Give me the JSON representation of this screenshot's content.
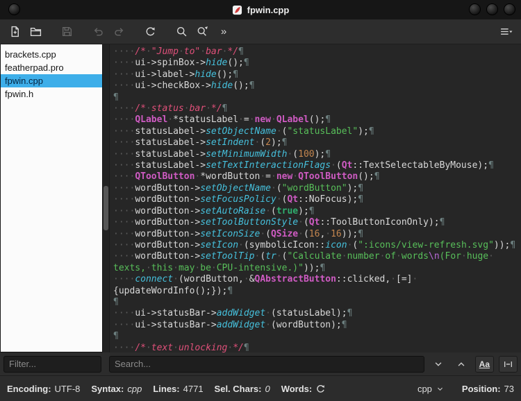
{
  "window": {
    "title": "fpwin.cpp"
  },
  "toolbar": {
    "overflow_label": "»",
    "icons": [
      "new-file-icon",
      "open-file-icon",
      "save-icon",
      "undo-icon",
      "redo-icon",
      "reload-icon",
      "search-icon",
      "find-replace-icon",
      "overflow-chevrons",
      "menu-icon"
    ]
  },
  "sidebar": {
    "filter_placeholder": "Filter...",
    "files": [
      {
        "name": "brackets.cpp",
        "selected": false
      },
      {
        "name": "featherpad.pro",
        "selected": false
      },
      {
        "name": "fpwin.cpp",
        "selected": true
      },
      {
        "name": "fpwin.h",
        "selected": false
      }
    ]
  },
  "search": {
    "placeholder": "Search...",
    "case_button_label": "Aa"
  },
  "statusbar": {
    "encoding_label": "Encoding:",
    "encoding_value": "UTF-8",
    "syntax_label": "Syntax:",
    "syntax_value": "cpp",
    "lines_label": "Lines:",
    "lines_value": "4771",
    "sel_label": "Sel. Chars:",
    "sel_value": "0",
    "words_label": "Words:",
    "lang_combo_value": "cpp",
    "position_label": "Position:",
    "position_value": "73"
  },
  "editor": {
    "rows": [
      [
        [
          "ws",
          "····"
        ],
        [
          "c",
          "/*"
        ],
        [
          "ws",
          "·"
        ],
        [
          "c",
          "\"Jump"
        ],
        [
          "ws",
          "·"
        ],
        [
          "c",
          "to\""
        ],
        [
          "ws",
          "·"
        ],
        [
          "c",
          "bar"
        ],
        [
          "ws",
          "·"
        ],
        [
          "c",
          "*/"
        ],
        [
          "pi",
          "¶"
        ]
      ],
      [
        [
          "ws",
          "····"
        ],
        [
          "p",
          "ui->spinBox->"
        ],
        [
          "f",
          "hide"
        ],
        [
          "p",
          "();"
        ],
        [
          "pi",
          "¶"
        ]
      ],
      [
        [
          "ws",
          "····"
        ],
        [
          "p",
          "ui->label->"
        ],
        [
          "f",
          "hide"
        ],
        [
          "p",
          "();"
        ],
        [
          "pi",
          "¶"
        ]
      ],
      [
        [
          "ws",
          "····"
        ],
        [
          "p",
          "ui->checkBox->"
        ],
        [
          "f",
          "hide"
        ],
        [
          "p",
          "();"
        ],
        [
          "pi",
          "¶"
        ]
      ],
      [
        [
          "pi",
          "¶"
        ]
      ],
      [
        [
          "ws",
          "····"
        ],
        [
          "c",
          "/*"
        ],
        [
          "ws",
          "·"
        ],
        [
          "c",
          "status"
        ],
        [
          "ws",
          "·"
        ],
        [
          "c",
          "bar"
        ],
        [
          "ws",
          "·"
        ],
        [
          "c",
          "*/"
        ],
        [
          "pi",
          "¶"
        ]
      ],
      [
        [
          "ws",
          "····"
        ],
        [
          "k",
          "QLabel"
        ],
        [
          "ws",
          "·"
        ],
        [
          "p",
          "*statusLabel"
        ],
        [
          "ws",
          "·"
        ],
        [
          "p",
          "="
        ],
        [
          "ws",
          "·"
        ],
        [
          "k",
          "new"
        ],
        [
          "ws",
          "·"
        ],
        [
          "k",
          "QLabel"
        ],
        [
          "p",
          "();"
        ],
        [
          "pi",
          "¶"
        ]
      ],
      [
        [
          "ws",
          "····"
        ],
        [
          "p",
          "statusLabel->"
        ],
        [
          "f",
          "setObjectName"
        ],
        [
          "ws",
          "·"
        ],
        [
          "p",
          "("
        ],
        [
          "s",
          "\"statusLabel\""
        ],
        [
          "p",
          ");"
        ],
        [
          "pi",
          "¶"
        ]
      ],
      [
        [
          "ws",
          "····"
        ],
        [
          "p",
          "statusLabel->"
        ],
        [
          "f",
          "setIndent"
        ],
        [
          "ws",
          "·"
        ],
        [
          "p",
          "("
        ],
        [
          "n",
          "2"
        ],
        [
          "p",
          ");"
        ],
        [
          "pi",
          "¶"
        ]
      ],
      [
        [
          "ws",
          "····"
        ],
        [
          "p",
          "statusLabel->"
        ],
        [
          "f",
          "setMinimumWidth"
        ],
        [
          "ws",
          "·"
        ],
        [
          "p",
          "("
        ],
        [
          "n",
          "100"
        ],
        [
          "p",
          ");"
        ],
        [
          "pi",
          "¶"
        ]
      ],
      [
        [
          "ws",
          "····"
        ],
        [
          "p",
          "statusLabel->"
        ],
        [
          "f",
          "setTextInteractionFlags"
        ],
        [
          "ws",
          "·"
        ],
        [
          "p",
          "("
        ],
        [
          "k",
          "Qt"
        ],
        [
          "p",
          "::TextSelectableByMouse);"
        ],
        [
          "pi",
          "¶"
        ]
      ],
      [
        [
          "ws",
          "····"
        ],
        [
          "k",
          "QToolButton"
        ],
        [
          "ws",
          "·"
        ],
        [
          "p",
          "*wordButton"
        ],
        [
          "ws",
          "·"
        ],
        [
          "p",
          "="
        ],
        [
          "ws",
          "·"
        ],
        [
          "k",
          "new"
        ],
        [
          "ws",
          "·"
        ],
        [
          "k",
          "QToolButton"
        ],
        [
          "p",
          "();"
        ],
        [
          "pi",
          "¶"
        ]
      ],
      [
        [
          "ws",
          "····"
        ],
        [
          "p",
          "wordButton->"
        ],
        [
          "f",
          "setObjectName"
        ],
        [
          "ws",
          "·"
        ],
        [
          "p",
          "("
        ],
        [
          "s",
          "\"wordButton\""
        ],
        [
          "p",
          ");"
        ],
        [
          "pi",
          "¶"
        ]
      ],
      [
        [
          "ws",
          "····"
        ],
        [
          "p",
          "wordButton->"
        ],
        [
          "f",
          "setFocusPolicy"
        ],
        [
          "ws",
          "·"
        ],
        [
          "p",
          "("
        ],
        [
          "k",
          "Qt"
        ],
        [
          "p",
          "::NoFocus);"
        ],
        [
          "pi",
          "¶"
        ]
      ],
      [
        [
          "ws",
          "····"
        ],
        [
          "p",
          "wordButton->"
        ],
        [
          "f",
          "setAutoRaise"
        ],
        [
          "ws",
          "·"
        ],
        [
          "p",
          "("
        ],
        [
          "b",
          "true"
        ],
        [
          "p",
          ");"
        ],
        [
          "pi",
          "¶"
        ]
      ],
      [
        [
          "ws",
          "····"
        ],
        [
          "p",
          "wordButton->"
        ],
        [
          "f",
          "setToolButtonStyle"
        ],
        [
          "ws",
          "·"
        ],
        [
          "p",
          "("
        ],
        [
          "k",
          "Qt"
        ],
        [
          "p",
          "::ToolButtonIconOnly);"
        ],
        [
          "pi",
          "¶"
        ]
      ],
      [
        [
          "ws",
          "····"
        ],
        [
          "p",
          "wordButton->"
        ],
        [
          "f",
          "setIconSize"
        ],
        [
          "ws",
          "·"
        ],
        [
          "p",
          "("
        ],
        [
          "k",
          "QSize"
        ],
        [
          "ws",
          "·"
        ],
        [
          "p",
          "("
        ],
        [
          "n",
          "16"
        ],
        [
          "p",
          ","
        ],
        [
          "ws",
          "·"
        ],
        [
          "n",
          "16"
        ],
        [
          "p",
          "));"
        ],
        [
          "pi",
          "¶"
        ]
      ],
      [
        [
          "ws",
          "····"
        ],
        [
          "p",
          "wordButton->"
        ],
        [
          "f",
          "setIcon"
        ],
        [
          "ws",
          "·"
        ],
        [
          "p",
          "(symbolicIcon::"
        ],
        [
          "f",
          "icon"
        ],
        [
          "ws",
          "·"
        ],
        [
          "p",
          "("
        ],
        [
          "s",
          "\":icons/view-refresh.svg\""
        ],
        [
          "p",
          "));"
        ],
        [
          "pi",
          "¶"
        ]
      ],
      [
        [
          "ws",
          "····"
        ],
        [
          "p",
          "wordButton->"
        ],
        [
          "f",
          "setToolTip"
        ],
        [
          "ws",
          "·"
        ],
        [
          "p",
          "("
        ],
        [
          "f",
          "tr"
        ],
        [
          "ws",
          "·"
        ],
        [
          "p",
          "("
        ],
        [
          "s",
          "\"Calculate"
        ],
        [
          "ws",
          "·"
        ],
        [
          "s",
          "number"
        ],
        [
          "ws",
          "·"
        ],
        [
          "s",
          "of"
        ],
        [
          "ws",
          "·"
        ],
        [
          "s",
          "words"
        ],
        [
          "e",
          "\\n"
        ],
        [
          "s",
          "(For"
        ],
        [
          "ws",
          "·"
        ],
        [
          "s",
          "huge"
        ],
        [
          "ws",
          "·"
        ]
      ],
      [
        [
          "s",
          "texts,"
        ],
        [
          "ws",
          "·"
        ],
        [
          "s",
          "this"
        ],
        [
          "ws",
          "·"
        ],
        [
          "s",
          "may"
        ],
        [
          "ws",
          "·"
        ],
        [
          "s",
          "be"
        ],
        [
          "ws",
          "·"
        ],
        [
          "s",
          "CPU-intensive.)\""
        ],
        [
          "p",
          "));"
        ],
        [
          "pi",
          "¶"
        ]
      ],
      [
        [
          "ws",
          "····"
        ],
        [
          "f",
          "connect"
        ],
        [
          "ws",
          "·"
        ],
        [
          "p",
          "(wordButton,"
        ],
        [
          "ws",
          "·"
        ],
        [
          "p",
          "&"
        ],
        [
          "k",
          "QAbstractButton"
        ],
        [
          "p",
          "::clicked,"
        ],
        [
          "ws",
          "·"
        ],
        [
          "p",
          "[=]"
        ],
        [
          "ws",
          "·"
        ]
      ],
      [
        [
          "p",
          "{updateWordInfo();});"
        ],
        [
          "pi",
          "¶"
        ]
      ],
      [
        [
          "pi",
          "¶"
        ]
      ],
      [
        [
          "ws",
          "····"
        ],
        [
          "p",
          "ui->statusBar->"
        ],
        [
          "f",
          "addWidget"
        ],
        [
          "ws",
          "·"
        ],
        [
          "p",
          "(statusLabel);"
        ],
        [
          "pi",
          "¶"
        ]
      ],
      [
        [
          "ws",
          "····"
        ],
        [
          "p",
          "ui->statusBar->"
        ],
        [
          "f",
          "addWidget"
        ],
        [
          "ws",
          "·"
        ],
        [
          "p",
          "(wordButton);"
        ],
        [
          "pi",
          "¶"
        ]
      ],
      [
        [
          "pi",
          "¶"
        ]
      ],
      [
        [
          "ws",
          "····"
        ],
        [
          "c",
          "/*"
        ],
        [
          "ws",
          "·"
        ],
        [
          "c",
          "text"
        ],
        [
          "ws",
          "·"
        ],
        [
          "c",
          "unlocking"
        ],
        [
          "ws",
          "·"
        ],
        [
          "c",
          "*/"
        ],
        [
          "pi",
          "¶"
        ]
      ]
    ]
  }
}
